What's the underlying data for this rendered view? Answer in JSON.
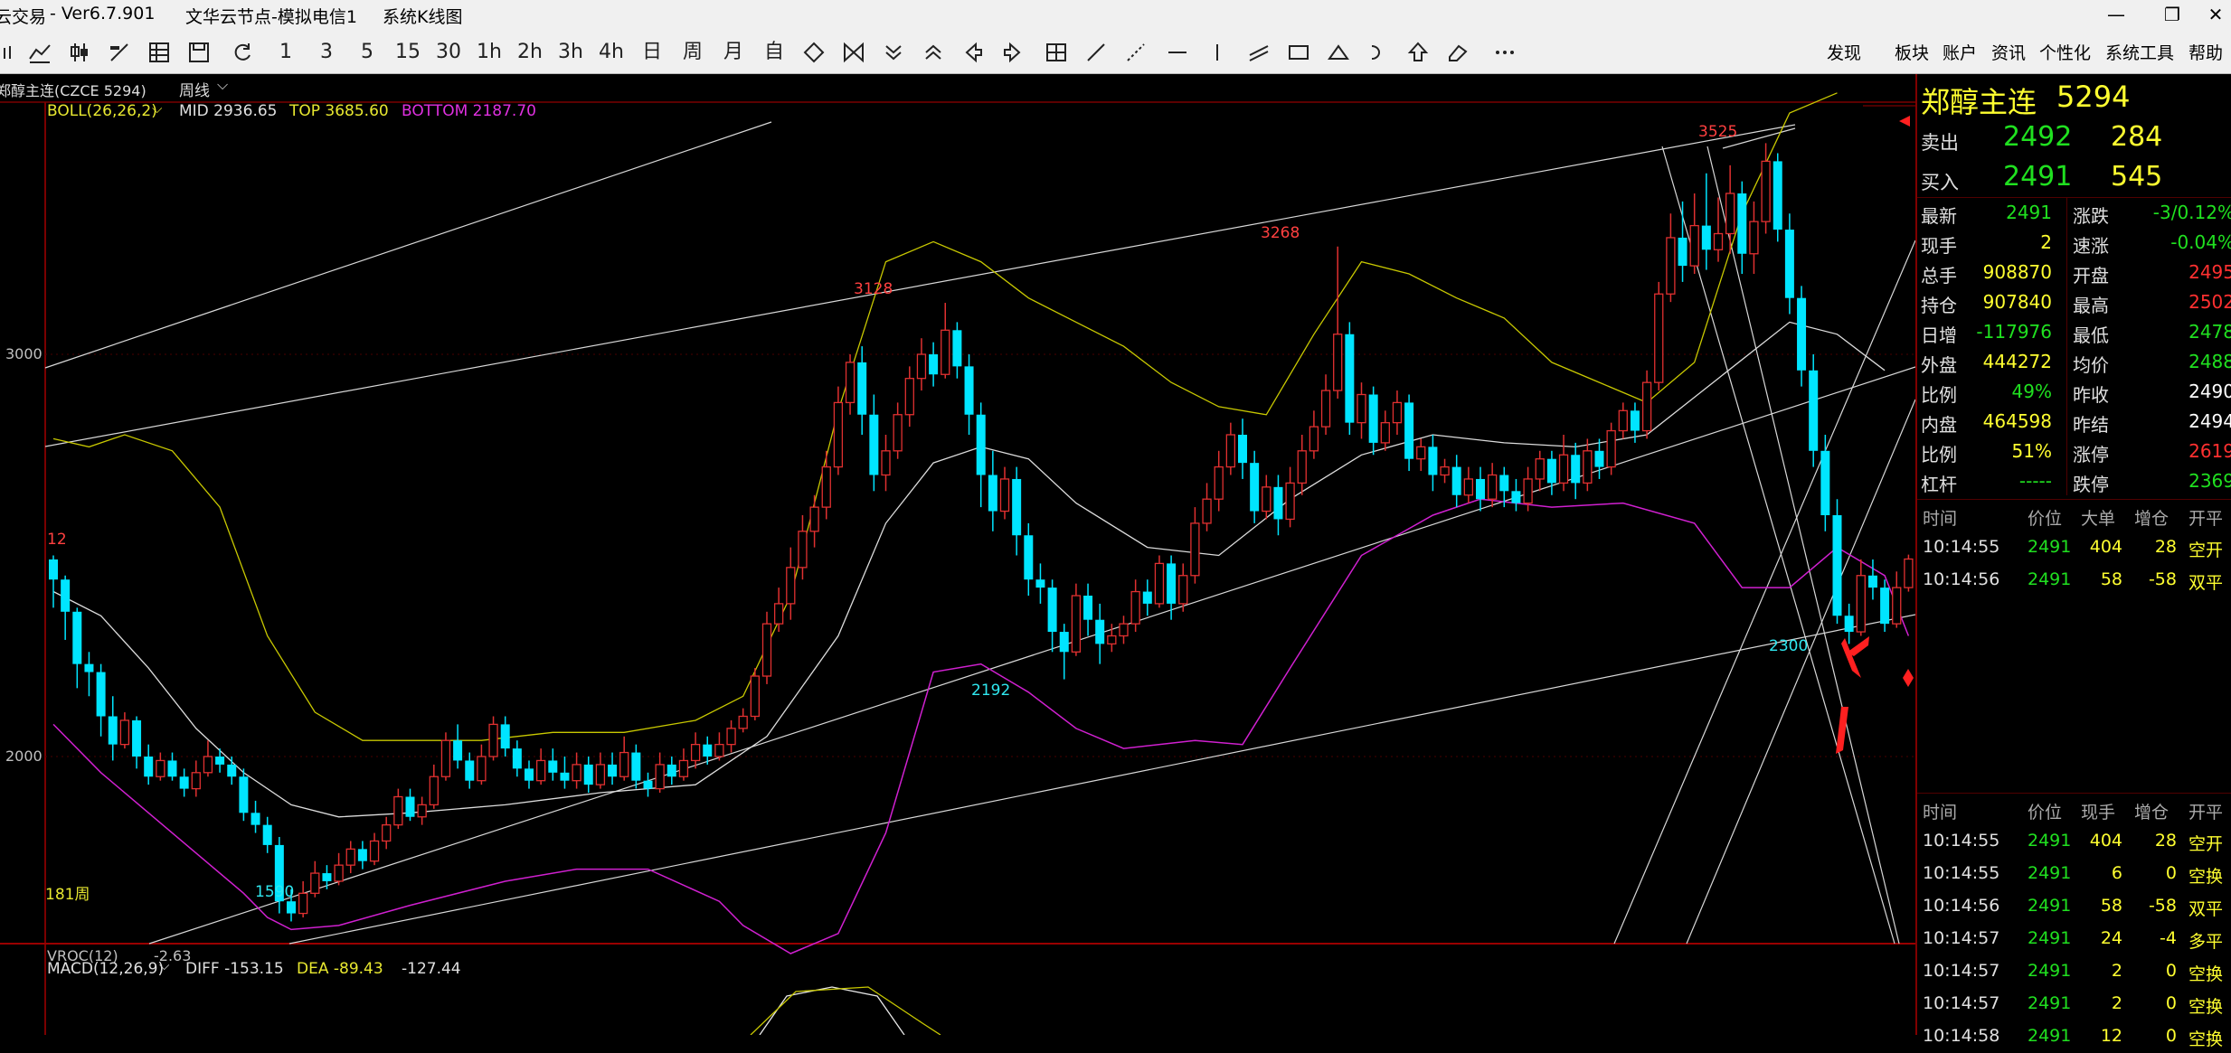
{
  "window": {
    "app_fragment": "云交易",
    "version": "-  Ver6.7.901",
    "server": "文华云节点-模拟电信1",
    "chart_kind": "系统K线图",
    "controls": [
      "—",
      "❐",
      "✕"
    ]
  },
  "toolbar": {
    "periods": [
      "1",
      "3",
      "5",
      "15",
      "30",
      "1h",
      "2h",
      "3h",
      "4h",
      "日",
      "周",
      "月",
      "自"
    ],
    "menu": [
      "发现",
      "板块",
      "账户",
      "资讯",
      "个性化",
      "系统工具",
      "帮助"
    ]
  },
  "chart_header": {
    "symbol": "郑醇主连(CZCE 5294)",
    "period": "周线",
    "indicator": "BOLL(26,26,2)",
    "mid": "MID 2936.65",
    "top": "TOP 3685.60",
    "bottom": "BOTTOM 2187.70"
  },
  "price_axis": {
    "labels": [
      "3000",
      "2000"
    ]
  },
  "annotations": {
    "high_1": "3128",
    "high_2": "3268",
    "high_3": "3525",
    "low_1": "1590",
    "low_2": "2192",
    "low_3": "2300",
    "left_marker": "12",
    "bar_count": "181周"
  },
  "sub_chart": {
    "vroc_label": "VROC(12)",
    "vroc_value": "-2.63",
    "macd_label": "MACD(12,26,9)",
    "diff": "DIFF -153.15",
    "dea": "DEA -89.43",
    "macd": "-127.44"
  },
  "quote": {
    "name": "郑醇主连",
    "code": "5294",
    "ask_label": "卖出",
    "ask_price": "2492",
    "ask_vol": "284",
    "bid_label": "买入",
    "bid_price": "2491",
    "bid_vol": "545",
    "rows": [
      {
        "l1": "最新",
        "v1": "2491",
        "l2": "涨跌",
        "v2": "-3/0.12%"
      },
      {
        "l1": "现手",
        "v1": "2",
        "l2": "速涨",
        "v2": "-0.04%"
      },
      {
        "l1": "总手",
        "v1": "908870",
        "l2": "开盘",
        "v2": "2495"
      },
      {
        "l1": "持仓",
        "v1": "907840",
        "l2": "最高",
        "v2": "2502"
      },
      {
        "l1": "日增",
        "v1": "-117976",
        "l2": "最低",
        "v2": "2478"
      },
      {
        "l1": "外盘",
        "v1": "444272",
        "l2": "均价",
        "v2": "2488"
      },
      {
        "l1": "比例",
        "v1": "49%",
        "l2": "昨收",
        "v2": "2490"
      },
      {
        "l1": "内盘",
        "v1": "464598",
        "l2": "昨结",
        "v2": "2494"
      },
      {
        "l1": "比例",
        "v1": "51%",
        "l2": "涨停",
        "v2": "2619"
      },
      {
        "l1": "杠杆",
        "v1": "-----",
        "l2": "跌停",
        "v2": "2369"
      }
    ],
    "trade_headers": [
      "时间",
      "价位",
      "大单",
      "增仓",
      "开平"
    ],
    "big_trades": [
      {
        "t": "10:14:55",
        "p": "2491",
        "v": "404",
        "d": "28",
        "k": "空开"
      },
      {
        "t": "10:14:56",
        "p": "2491",
        "v": "58",
        "d": "-58",
        "k": "双平"
      }
    ],
    "tick_headers": [
      "时间",
      "价位",
      "现手",
      "增仓",
      "开平"
    ],
    "ticks": [
      {
        "t": "10:14:55",
        "p": "2491",
        "v": "404",
        "d": "28",
        "k": "空开"
      },
      {
        "t": "10:14:55",
        "p": "2491",
        "v": "6",
        "d": "0",
        "k": "空换"
      },
      {
        "t": "10:14:56",
        "p": "2491",
        "v": "58",
        "d": "-58",
        "k": "双平"
      },
      {
        "t": "10:14:57",
        "p": "2491",
        "v": "24",
        "d": "-4",
        "k": "多平"
      },
      {
        "t": "10:14:57",
        "p": "2491",
        "v": "2",
        "d": "0",
        "k": "空换"
      },
      {
        "t": "10:14:57",
        "p": "2491",
        "v": "2",
        "d": "0",
        "k": "空换"
      },
      {
        "t": "10:14:58",
        "p": "2491",
        "v": "12",
        "d": "0",
        "k": "空换"
      }
    ]
  },
  "colors": {
    "up": "#e03030",
    "down": "#00e5ff",
    "boll_top": "#c8c800",
    "boll_mid": "#dcdcdc",
    "boll_bottom": "#d020d0",
    "green": "#20e020",
    "red": "#ff3030",
    "yellow": "#ffff30"
  },
  "chart_data": {
    "type": "candlestick",
    "period": "weekly",
    "ylim": [
      1450,
      3700
    ],
    "candles": [
      [
        2490,
        2440,
        2500,
        2370
      ],
      [
        2440,
        2360,
        2450,
        2290
      ],
      [
        2360,
        2230,
        2370,
        2170
      ],
      [
        2230,
        2210,
        2260,
        2150
      ],
      [
        2210,
        2100,
        2230,
        2050
      ],
      [
        2100,
        2030,
        2150,
        1990
      ],
      [
        2030,
        2090,
        2110,
        2020
      ],
      [
        2090,
        2000,
        2100,
        1970
      ],
      [
        2000,
        1950,
        2030,
        1930
      ],
      [
        1950,
        1990,
        2010,
        1940
      ],
      [
        1990,
        1950,
        2010,
        1940
      ],
      [
        1950,
        1920,
        1970,
        1900
      ],
      [
        1920,
        1960,
        1990,
        1900
      ],
      [
        1960,
        2000,
        2040,
        1950
      ],
      [
        2000,
        1980,
        2020,
        1960
      ],
      [
        1980,
        1950,
        2000,
        1930
      ],
      [
        1950,
        1860,
        1970,
        1840
      ],
      [
        1860,
        1830,
        1890,
        1810
      ],
      [
        1830,
        1780,
        1850,
        1760
      ],
      [
        1780,
        1640,
        1800,
        1610
      ],
      [
        1640,
        1610,
        1670,
        1590
      ],
      [
        1610,
        1660,
        1690,
        1600
      ],
      [
        1660,
        1710,
        1740,
        1650
      ],
      [
        1710,
        1690,
        1730,
        1670
      ],
      [
        1690,
        1730,
        1760,
        1680
      ],
      [
        1730,
        1770,
        1790,
        1710
      ],
      [
        1770,
        1740,
        1790,
        1720
      ],
      [
        1740,
        1790,
        1810,
        1730
      ],
      [
        1790,
        1830,
        1850,
        1770
      ],
      [
        1830,
        1900,
        1920,
        1820
      ],
      [
        1900,
        1850,
        1920,
        1840
      ],
      [
        1850,
        1880,
        1900,
        1830
      ],
      [
        1880,
        1950,
        1980,
        1870
      ],
      [
        1950,
        2040,
        2060,
        1940
      ],
      [
        2040,
        1990,
        2080,
        1970
      ],
      [
        1990,
        1940,
        2010,
        1920
      ],
      [
        1940,
        2000,
        2030,
        1930
      ],
      [
        2000,
        2080,
        2100,
        1990
      ],
      [
        2080,
        2020,
        2100,
        2000
      ],
      [
        2020,
        1970,
        2040,
        1950
      ],
      [
        1970,
        1940,
        1990,
        1920
      ],
      [
        1940,
        1990,
        2020,
        1930
      ],
      [
        1990,
        1960,
        2020,
        1940
      ],
      [
        1960,
        1940,
        2000,
        1920
      ],
      [
        1940,
        1980,
        2010,
        1920
      ],
      [
        1980,
        1930,
        2000,
        1910
      ],
      [
        1930,
        1980,
        2010,
        1920
      ],
      [
        1980,
        1950,
        2010,
        1930
      ],
      [
        1950,
        2010,
        2050,
        1940
      ],
      [
        2010,
        1940,
        2030,
        1920
      ],
      [
        1940,
        1920,
        1960,
        1900
      ],
      [
        1920,
        1980,
        2010,
        1910
      ],
      [
        1980,
        1950,
        2000,
        1930
      ],
      [
        1950,
        1990,
        2020,
        1940
      ],
      [
        1990,
        2030,
        2060,
        1970
      ],
      [
        2030,
        2000,
        2050,
        1980
      ],
      [
        2000,
        2030,
        2060,
        1990
      ],
      [
        2030,
        2070,
        2090,
        2010
      ],
      [
        2070,
        2100,
        2120,
        2060
      ],
      [
        2100,
        2200,
        2220,
        2090
      ],
      [
        2200,
        2330,
        2360,
        2180
      ],
      [
        2330,
        2380,
        2420,
        2310
      ],
      [
        2380,
        2470,
        2520,
        2340
      ],
      [
        2470,
        2560,
        2600,
        2440
      ],
      [
        2560,
        2620,
        2650,
        2520
      ],
      [
        2620,
        2720,
        2760,
        2590
      ],
      [
        2720,
        2880,
        2920,
        2700
      ],
      [
        2880,
        2980,
        3000,
        2850
      ],
      [
        2980,
        2850,
        3020,
        2800
      ],
      [
        2850,
        2700,
        2900,
        2660
      ],
      [
        2700,
        2760,
        2800,
        2660
      ],
      [
        2760,
        2850,
        2880,
        2740
      ],
      [
        2850,
        2940,
        2970,
        2820
      ],
      [
        2940,
        3000,
        3040,
        2910
      ],
      [
        3000,
        2950,
        3030,
        2920
      ],
      [
        2950,
        3060,
        3128,
        2940
      ],
      [
        3060,
        2970,
        3080,
        2940
      ],
      [
        2970,
        2850,
        3000,
        2800
      ],
      [
        2850,
        2700,
        2880,
        2620
      ],
      [
        2700,
        2610,
        2760,
        2560
      ],
      [
        2610,
        2690,
        2720,
        2590
      ],
      [
        2690,
        2550,
        2720,
        2500
      ],
      [
        2550,
        2440,
        2580,
        2400
      ],
      [
        2440,
        2420,
        2480,
        2380
      ],
      [
        2420,
        2310,
        2440,
        2260
      ],
      [
        2310,
        2260,
        2330,
        2192
      ],
      [
        2260,
        2400,
        2430,
        2250
      ],
      [
        2400,
        2340,
        2430,
        2300
      ],
      [
        2340,
        2280,
        2380,
        2230
      ],
      [
        2280,
        2300,
        2330,
        2260
      ],
      [
        2300,
        2330,
        2350,
        2280
      ],
      [
        2330,
        2410,
        2440,
        2310
      ],
      [
        2410,
        2380,
        2440,
        2350
      ],
      [
        2380,
        2480,
        2500,
        2370
      ],
      [
        2480,
        2380,
        2500,
        2340
      ],
      [
        2380,
        2450,
        2480,
        2360
      ],
      [
        2450,
        2580,
        2620,
        2430
      ],
      [
        2580,
        2640,
        2680,
        2560
      ],
      [
        2640,
        2720,
        2760,
        2610
      ],
      [
        2720,
        2800,
        2830,
        2700
      ],
      [
        2800,
        2730,
        2840,
        2690
      ],
      [
        2730,
        2610,
        2760,
        2580
      ],
      [
        2610,
        2670,
        2700,
        2590
      ],
      [
        2670,
        2590,
        2700,
        2550
      ],
      [
        2590,
        2680,
        2720,
        2570
      ],
      [
        2680,
        2760,
        2800,
        2650
      ],
      [
        2760,
        2820,
        2860,
        2740
      ],
      [
        2820,
        2910,
        2950,
        2800
      ],
      [
        2910,
        3050,
        3268,
        2890
      ],
      [
        3050,
        2830,
        3080,
        2800
      ],
      [
        2830,
        2900,
        2930,
        2790
      ],
      [
        2900,
        2780,
        2920,
        2750
      ],
      [
        2780,
        2830,
        2860,
        2760
      ],
      [
        2830,
        2880,
        2910,
        2800
      ],
      [
        2880,
        2740,
        2900,
        2710
      ],
      [
        2740,
        2770,
        2790,
        2710
      ],
      [
        2770,
        2700,
        2800,
        2660
      ],
      [
        2700,
        2720,
        2740,
        2680
      ],
      [
        2720,
        2650,
        2750,
        2620
      ],
      [
        2650,
        2690,
        2720,
        2630
      ],
      [
        2690,
        2640,
        2720,
        2610
      ],
      [
        2640,
        2700,
        2730,
        2620
      ],
      [
        2700,
        2660,
        2720,
        2620
      ],
      [
        2660,
        2630,
        2690,
        2610
      ],
      [
        2630,
        2690,
        2720,
        2610
      ],
      [
        2690,
        2740,
        2760,
        2660
      ],
      [
        2740,
        2680,
        2760,
        2650
      ],
      [
        2680,
        2750,
        2800,
        2660
      ],
      [
        2750,
        2680,
        2780,
        2640
      ],
      [
        2680,
        2760,
        2790,
        2660
      ],
      [
        2760,
        2720,
        2790,
        2690
      ],
      [
        2720,
        2810,
        2830,
        2700
      ],
      [
        2810,
        2860,
        2880,
        2790
      ],
      [
        2860,
        2810,
        2880,
        2780
      ],
      [
        2810,
        2930,
        2960,
        2790
      ],
      [
        2930,
        3150,
        3180,
        2910
      ],
      [
        3150,
        3290,
        3350,
        3130
      ],
      [
        3290,
        3220,
        3380,
        3180
      ],
      [
        3220,
        3320,
        3400,
        3200
      ],
      [
        3320,
        3260,
        3450,
        3210
      ],
      [
        3260,
        3300,
        3390,
        3230
      ],
      [
        3300,
        3400,
        3470,
        3250
      ],
      [
        3400,
        3250,
        3430,
        3200
      ],
      [
        3250,
        3330,
        3380,
        3200
      ],
      [
        3330,
        3480,
        3525,
        3300
      ],
      [
        3480,
        3310,
        3500,
        3280
      ],
      [
        3310,
        3140,
        3350,
        3100
      ],
      [
        3140,
        2960,
        3170,
        2920
      ],
      [
        2960,
        2760,
        3000,
        2720
      ],
      [
        2760,
        2600,
        2800,
        2560
      ],
      [
        2600,
        2350,
        2640,
        2330
      ],
      [
        2350,
        2310,
        2380,
        2280
      ],
      [
        2310,
        2450,
        2490,
        2300
      ],
      [
        2450,
        2420,
        2490,
        2390
      ],
      [
        2420,
        2330,
        2440,
        2310
      ],
      [
        2330,
        2420,
        2460,
        2320
      ],
      [
        2420,
        2491,
        2502,
        2410
      ]
    ],
    "boll_top": [
      [
        0,
        2790
      ],
      [
        3,
        2770
      ],
      [
        6,
        2800
      ],
      [
        10,
        2760
      ],
      [
        14,
        2620
      ],
      [
        18,
        2300
      ],
      [
        22,
        2110
      ],
      [
        26,
        2040
      ],
      [
        30,
        2040
      ],
      [
        36,
        2040
      ],
      [
        42,
        2060
      ],
      [
        48,
        2060
      ],
      [
        54,
        2090
      ],
      [
        58,
        2150
      ],
      [
        62,
        2400
      ],
      [
        66,
        2860
      ],
      [
        70,
        3230
      ],
      [
        74,
        3280
      ],
      [
        78,
        3230
      ],
      [
        82,
        3140
      ],
      [
        86,
        3080
      ],
      [
        90,
        3020
      ],
      [
        94,
        2930
      ],
      [
        98,
        2870
      ],
      [
        102,
        2850
      ],
      [
        106,
        3050
      ],
      [
        110,
        3230
      ],
      [
        114,
        3200
      ],
      [
        118,
        3140
      ],
      [
        122,
        3090
      ],
      [
        126,
        2980
      ],
      [
        130,
        2930
      ],
      [
        134,
        2880
      ],
      [
        138,
        2980
      ],
      [
        142,
        3350
      ],
      [
        146,
        3600
      ],
      [
        150,
        3650
      ]
    ],
    "boll_mid": [
      [
        0,
        2410
      ],
      [
        4,
        2350
      ],
      [
        8,
        2220
      ],
      [
        12,
        2070
      ],
      [
        16,
        1960
      ],
      [
        20,
        1880
      ],
      [
        24,
        1850
      ],
      [
        30,
        1860
      ],
      [
        38,
        1880
      ],
      [
        46,
        1910
      ],
      [
        54,
        1930
      ],
      [
        60,
        2050
      ],
      [
        66,
        2300
      ],
      [
        70,
        2580
      ],
      [
        74,
        2730
      ],
      [
        78,
        2770
      ],
      [
        82,
        2740
      ],
      [
        86,
        2630
      ],
      [
        92,
        2520
      ],
      [
        98,
        2500
      ],
      [
        104,
        2640
      ],
      [
        110,
        2750
      ],
      [
        116,
        2800
      ],
      [
        122,
        2780
      ],
      [
        128,
        2770
      ],
      [
        134,
        2800
      ],
      [
        140,
        2940
      ],
      [
        146,
        3080
      ],
      [
        150,
        3050
      ],
      [
        154,
        2960
      ]
    ],
    "boll_bottom": [
      [
        0,
        2080
      ],
      [
        4,
        1960
      ],
      [
        8,
        1860
      ],
      [
        12,
        1760
      ],
      [
        16,
        1660
      ],
      [
        18,
        1600
      ],
      [
        20,
        1570
      ],
      [
        24,
        1580
      ],
      [
        30,
        1630
      ],
      [
        38,
        1690
      ],
      [
        44,
        1720
      ],
      [
        50,
        1720
      ],
      [
        56,
        1640
      ],
      [
        58,
        1580
      ],
      [
        62,
        1510
      ],
      [
        66,
        1560
      ],
      [
        70,
        1810
      ],
      [
        74,
        2210
      ],
      [
        78,
        2230
      ],
      [
        82,
        2160
      ],
      [
        86,
        2070
      ],
      [
        90,
        2020
      ],
      [
        96,
        2040
      ],
      [
        100,
        2030
      ],
      [
        104,
        2220
      ],
      [
        110,
        2500
      ],
      [
        116,
        2600
      ],
      [
        120,
        2640
      ],
      [
        126,
        2620
      ],
      [
        132,
        2630
      ],
      [
        138,
        2580
      ],
      [
        142,
        2420
      ],
      [
        146,
        2420
      ],
      [
        150,
        2520
      ],
      [
        154,
        2450
      ],
      [
        156,
        2300
      ]
    ]
  }
}
